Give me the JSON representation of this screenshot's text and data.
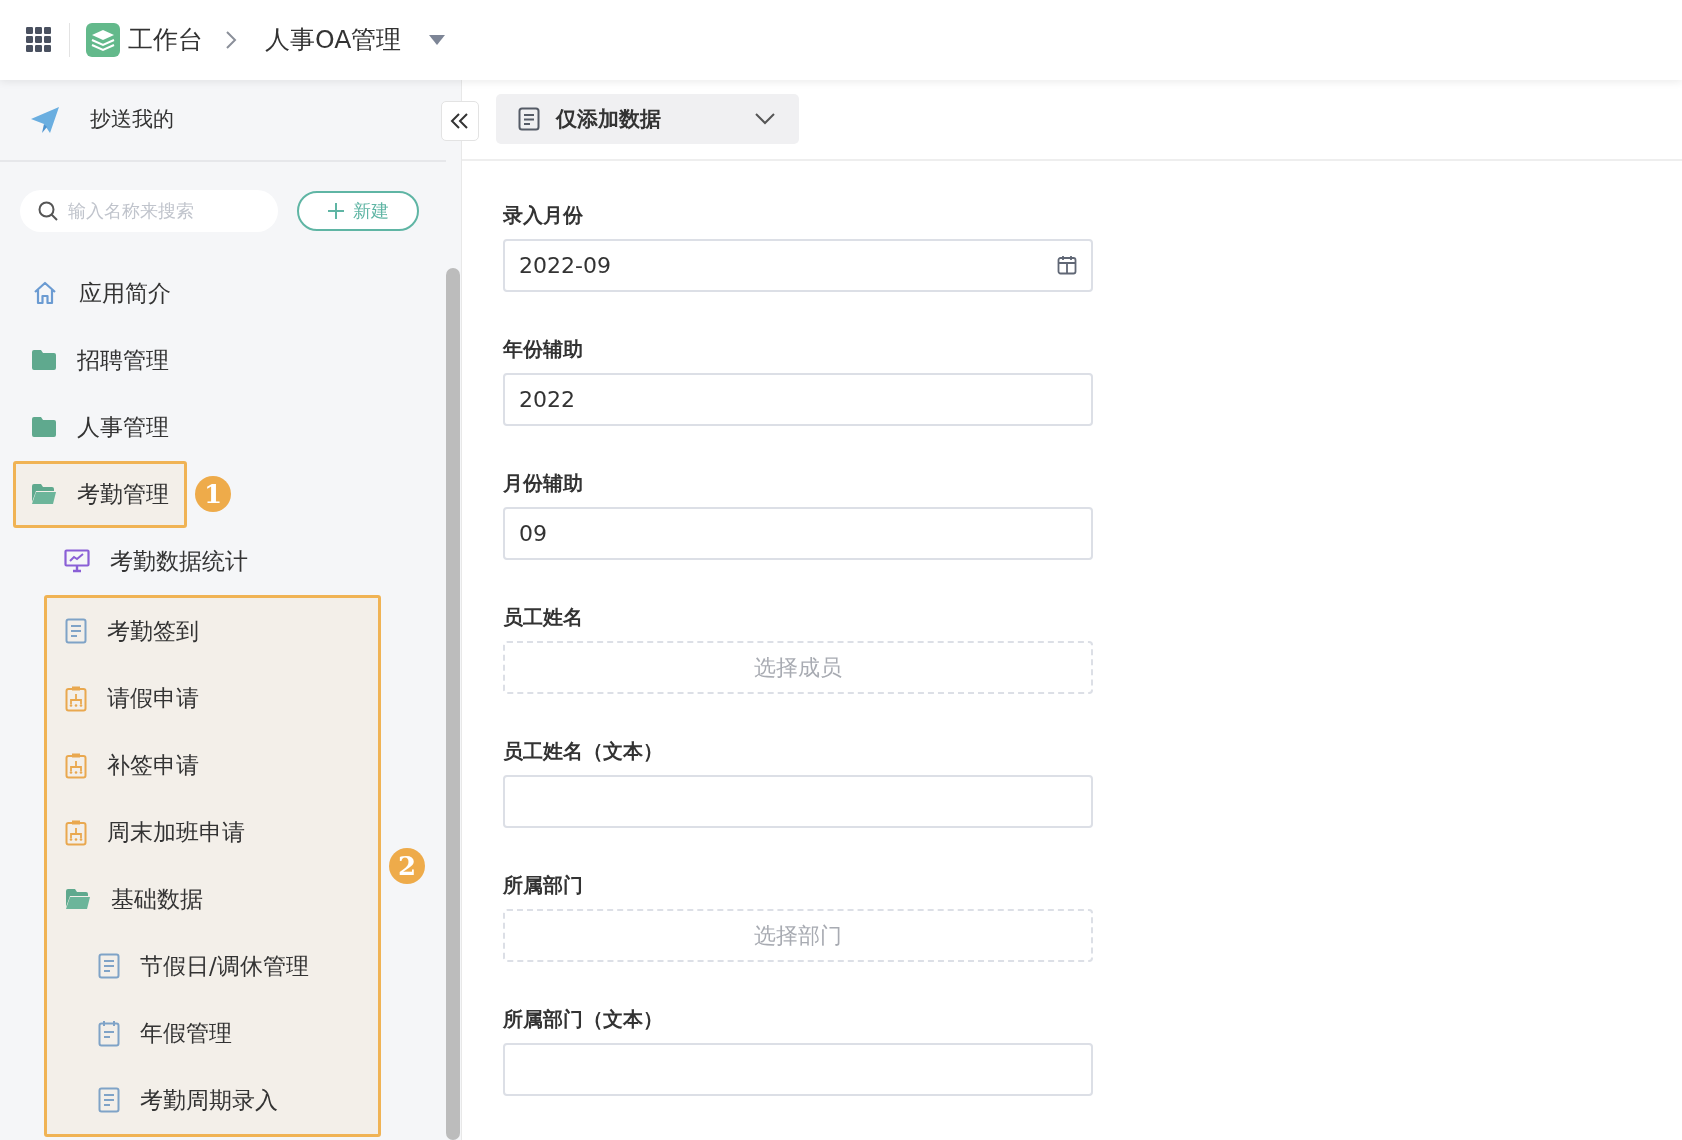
{
  "topbar": {
    "home": "工作台",
    "app": "人事OA管理"
  },
  "sidebar": {
    "top_item": "抄送我的",
    "search": {
      "placeholder": "输入名称来搜索"
    },
    "new_button": "新建",
    "items": [
      {
        "label": "应用简介",
        "kind": "home",
        "highlighted": false
      },
      {
        "label": "招聘管理",
        "kind": "folder",
        "highlighted": false
      },
      {
        "label": "人事管理",
        "kind": "folder",
        "highlighted": false
      },
      {
        "label": "考勤管理",
        "kind": "folder-open",
        "highlighted": true,
        "callout": "1",
        "children": [
          {
            "kind": "monitor",
            "label": "考勤数据统计"
          },
          {
            "kind": "group",
            "callout": "2",
            "children": [
              {
                "kind": "document",
                "label": "考勤签到"
              },
              {
                "kind": "clipboard",
                "label": "请假申请"
              },
              {
                "kind": "clipboard",
                "label": "补签申请"
              },
              {
                "kind": "clipboard",
                "label": "周末加班申请"
              },
              {
                "kind": "folder-open",
                "label": "基础数据",
                "children": [
                  {
                    "kind": "document",
                    "label": "节假日/调休管理"
                  },
                  {
                    "kind": "notepad",
                    "label": "年假管理"
                  },
                  {
                    "kind": "document",
                    "label": "考勤周期录入"
                  }
                ]
              }
            ]
          }
        ]
      }
    ]
  },
  "toolbar": {
    "view_dropdown": "仅添加数据"
  },
  "form": {
    "fields": [
      {
        "label": "录入月份",
        "kind": "date",
        "value": "2022-09"
      },
      {
        "label": "年份辅助",
        "kind": "text",
        "value": "2022"
      },
      {
        "label": "月份辅助",
        "kind": "text",
        "value": "09"
      },
      {
        "label": "员工姓名",
        "kind": "picker",
        "placeholder": "选择成员"
      },
      {
        "label": "员工姓名（文本）",
        "kind": "text"
      },
      {
        "label": "所属部门",
        "kind": "picker",
        "placeholder": "选择部门"
      },
      {
        "label": "所属部门（文本）",
        "kind": "text"
      }
    ]
  }
}
